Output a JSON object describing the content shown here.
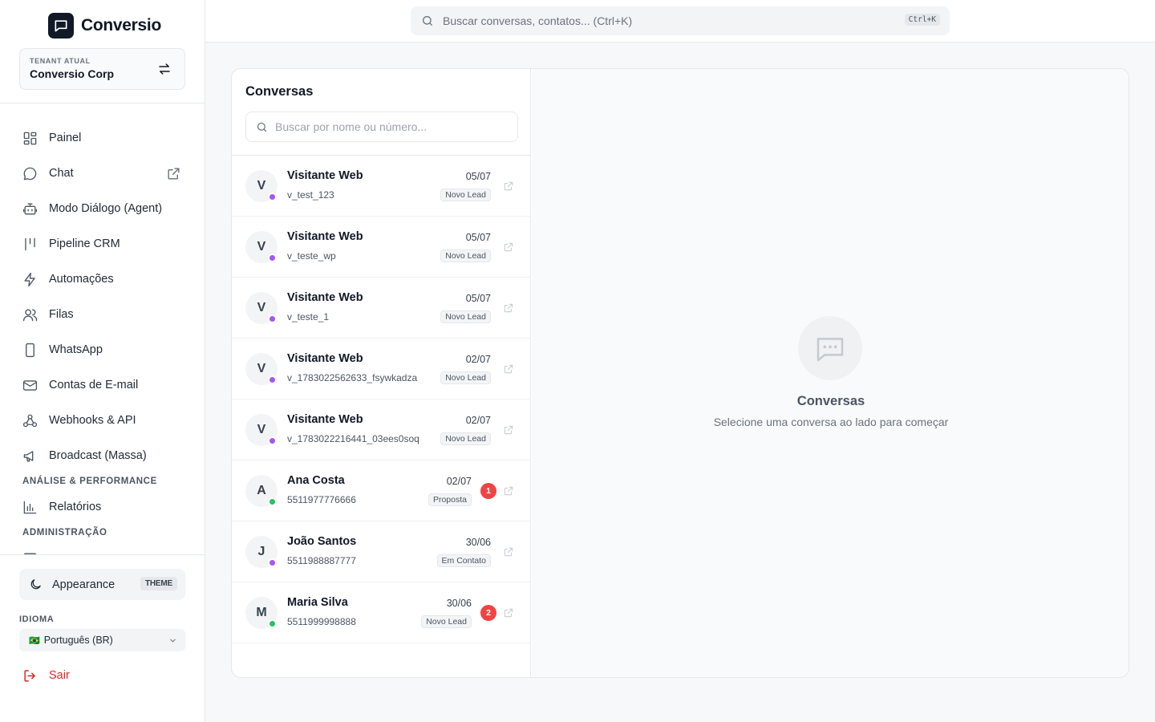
{
  "brand": {
    "name": "Conversio"
  },
  "tenant": {
    "label": "TENANT ATUAL",
    "name": "Conversio Corp"
  },
  "nav": {
    "items": [
      {
        "label": "Painel",
        "icon": "grid-icon"
      },
      {
        "label": "Chat",
        "icon": "chat-bubble-icon",
        "external": true
      },
      {
        "label": "Modo Diálogo (Agent)",
        "icon": "bot-icon"
      },
      {
        "label": "Pipeline CRM",
        "icon": "kanban-icon"
      },
      {
        "label": "Automações",
        "icon": "lightning-icon"
      },
      {
        "label": "Filas",
        "icon": "users-icon"
      },
      {
        "label": "WhatsApp",
        "icon": "phone-icon"
      },
      {
        "label": "Contas de E-mail",
        "icon": "mail-icon"
      },
      {
        "label": "Webhooks & API",
        "icon": "webhook-icon"
      },
      {
        "label": "Broadcast (Massa)",
        "icon": "megaphone-icon"
      }
    ],
    "section_analysis": "ANÁLISE & PERFORMANCE",
    "reports_label": "Relatórios",
    "section_admin": "ADMINISTRAÇÃO"
  },
  "appearance": {
    "label": "Appearance",
    "badge": "THEME"
  },
  "language": {
    "label": "IDIOMA",
    "flag": "🇧🇷",
    "value": "Português (BR)"
  },
  "logout": {
    "label": "Sair"
  },
  "search": {
    "placeholder": "Buscar conversas, contatos... (Ctrl+K)",
    "shortcut": "Ctrl+K"
  },
  "conversations": {
    "title": "Conversas",
    "search_placeholder": "Buscar por nome ou número...",
    "items": [
      {
        "initial": "V",
        "name": "Visitante Web",
        "sub": "v_test_123",
        "date": "05/07",
        "tag": "Novo Lead",
        "status_color": "#a855f7",
        "unread": ""
      },
      {
        "initial": "V",
        "name": "Visitante Web",
        "sub": "v_teste_wp",
        "date": "05/07",
        "tag": "Novo Lead",
        "status_color": "#a855f7",
        "unread": ""
      },
      {
        "initial": "V",
        "name": "Visitante Web",
        "sub": "v_teste_1",
        "date": "05/07",
        "tag": "Novo Lead",
        "status_color": "#a855f7",
        "unread": ""
      },
      {
        "initial": "V",
        "name": "Visitante Web",
        "sub": "v_1783022562633_fsywkadza",
        "date": "02/07",
        "tag": "Novo Lead",
        "status_color": "#a855f7",
        "unread": ""
      },
      {
        "initial": "V",
        "name": "Visitante Web",
        "sub": "v_1783022216441_03ees0soq",
        "date": "02/07",
        "tag": "Novo Lead",
        "status_color": "#a855f7",
        "unread": ""
      },
      {
        "initial": "A",
        "name": "Ana Costa",
        "sub": "5511977776666",
        "date": "02/07",
        "tag": "Proposta",
        "status_color": "#22c55e",
        "unread": "1"
      },
      {
        "initial": "J",
        "name": "João Santos",
        "sub": "5511988887777",
        "date": "30/06",
        "tag": "Em Contato",
        "status_color": "#a855f7",
        "unread": ""
      },
      {
        "initial": "M",
        "name": "Maria Silva",
        "sub": "5511999998888",
        "date": "30/06",
        "tag": "Novo Lead",
        "status_color": "#22c55e",
        "unread": "2"
      }
    ]
  },
  "empty_state": {
    "title": "Conversas",
    "subtitle": "Selecione uma conversa ao lado para começar"
  }
}
